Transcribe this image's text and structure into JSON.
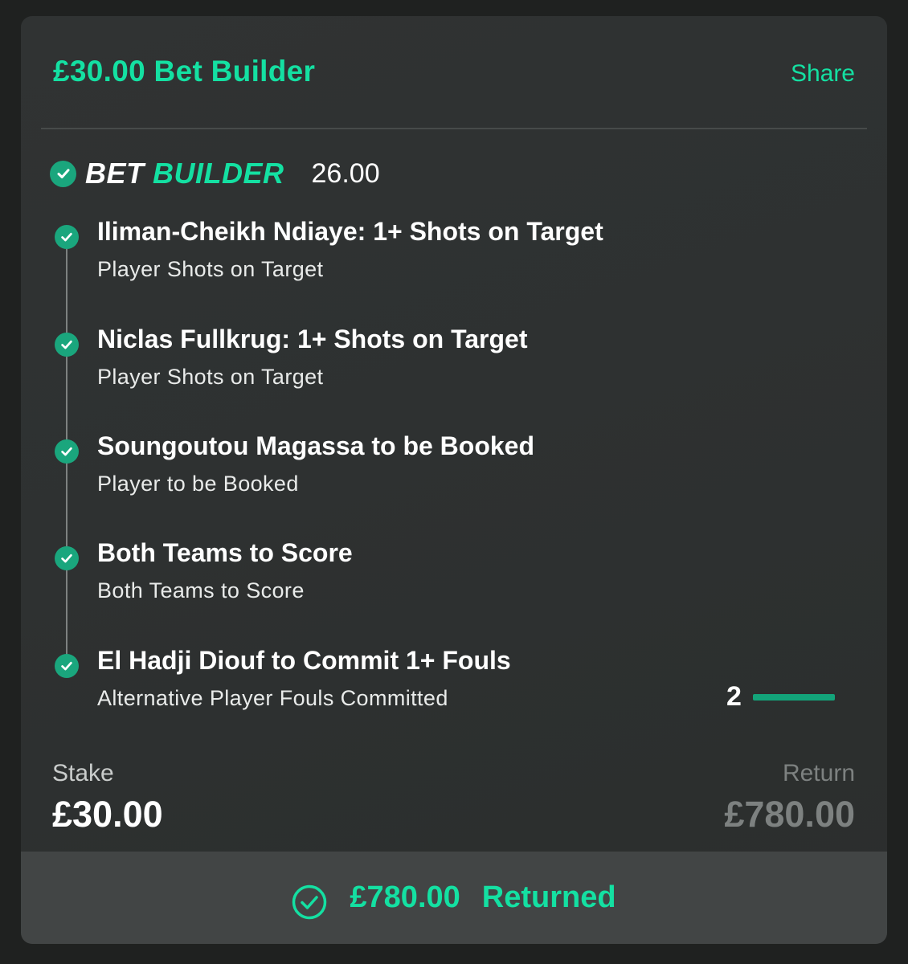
{
  "header": {
    "title": "£30.00 Bet Builder",
    "share_label": "Share"
  },
  "bet_builder": {
    "logo_word1": "BET",
    "logo_word2": "BUILDER",
    "odds": "26.00"
  },
  "selections": [
    {
      "title": "Iliman-Cheikh Ndiaye: 1+ Shots on Target",
      "market": "Player Shots on Target"
    },
    {
      "title": "Niclas Fullkrug: 1+ Shots on Target",
      "market": "Player Shots on Target"
    },
    {
      "title": "Soungoutou Magassa to be Booked",
      "market": "Player to be Booked"
    },
    {
      "title": "Both Teams to Score",
      "market": "Both Teams to Score"
    },
    {
      "title": "El Hadji Diouf to Commit 1+ Fouls",
      "market": "Alternative Player Fouls Committed"
    }
  ],
  "fouls_progress": {
    "count": "2",
    "fill_fraction": 1.0
  },
  "stake": {
    "label": "Stake",
    "value": "£30.00"
  },
  "return": {
    "label": "Return",
    "value": "£780.00"
  },
  "footer": {
    "amount": "£780.00",
    "status": "Returned"
  },
  "colors": {
    "accent": "#14e0a2",
    "check": "#1aa67d",
    "muted": "#7d8180"
  },
  "icons": {
    "selection_status": "check-circle-icon",
    "returned": "check-ring-icon"
  }
}
